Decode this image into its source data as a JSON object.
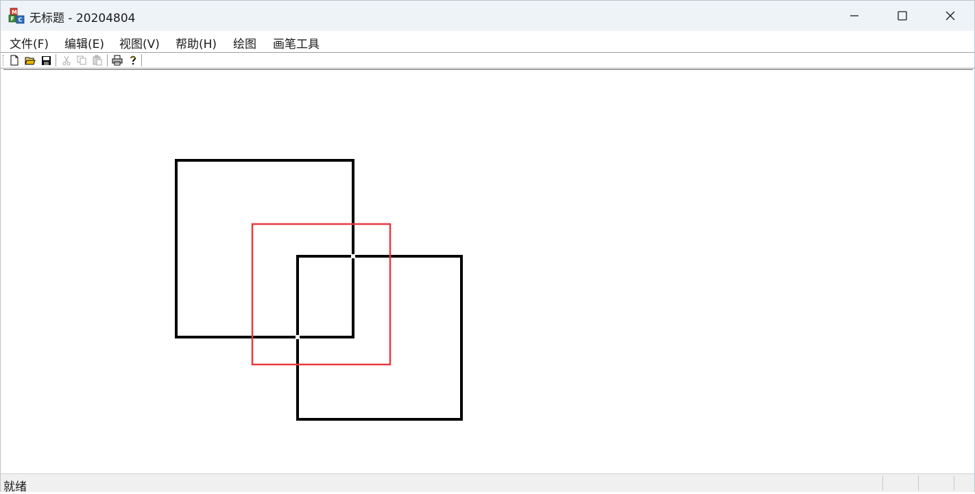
{
  "window": {
    "title": "无标题 - 20204804"
  },
  "menu": {
    "items": [
      {
        "label": "文件(F)"
      },
      {
        "label": "编辑(E)"
      },
      {
        "label": "视图(V)"
      },
      {
        "label": "帮助(H)"
      },
      {
        "label": "绘图"
      },
      {
        "label": "画笔工具"
      }
    ]
  },
  "toolbar": {
    "buttons": [
      {
        "icon": "new-file-icon",
        "enabled": true
      },
      {
        "icon": "open-folder-icon",
        "enabled": true
      },
      {
        "icon": "save-icon",
        "enabled": true
      },
      {
        "icon": "cut-icon",
        "enabled": false
      },
      {
        "icon": "copy-icon",
        "enabled": false
      },
      {
        "icon": "paste-icon",
        "enabled": false
      },
      {
        "icon": "print-icon",
        "enabled": true
      },
      {
        "icon": "help-icon",
        "enabled": true
      }
    ]
  },
  "canvas": {
    "shapes": [
      {
        "type": "rectangle",
        "stroke": "#000000"
      },
      {
        "type": "rectangle",
        "stroke": "#000000"
      },
      {
        "type": "rectangle",
        "stroke": "#e8393d"
      }
    ]
  },
  "status": {
    "text": "就绪"
  },
  "colors": {
    "titlebar": "#eef3f8",
    "shape_black": "#000000",
    "shape_red": "#e8393d"
  }
}
